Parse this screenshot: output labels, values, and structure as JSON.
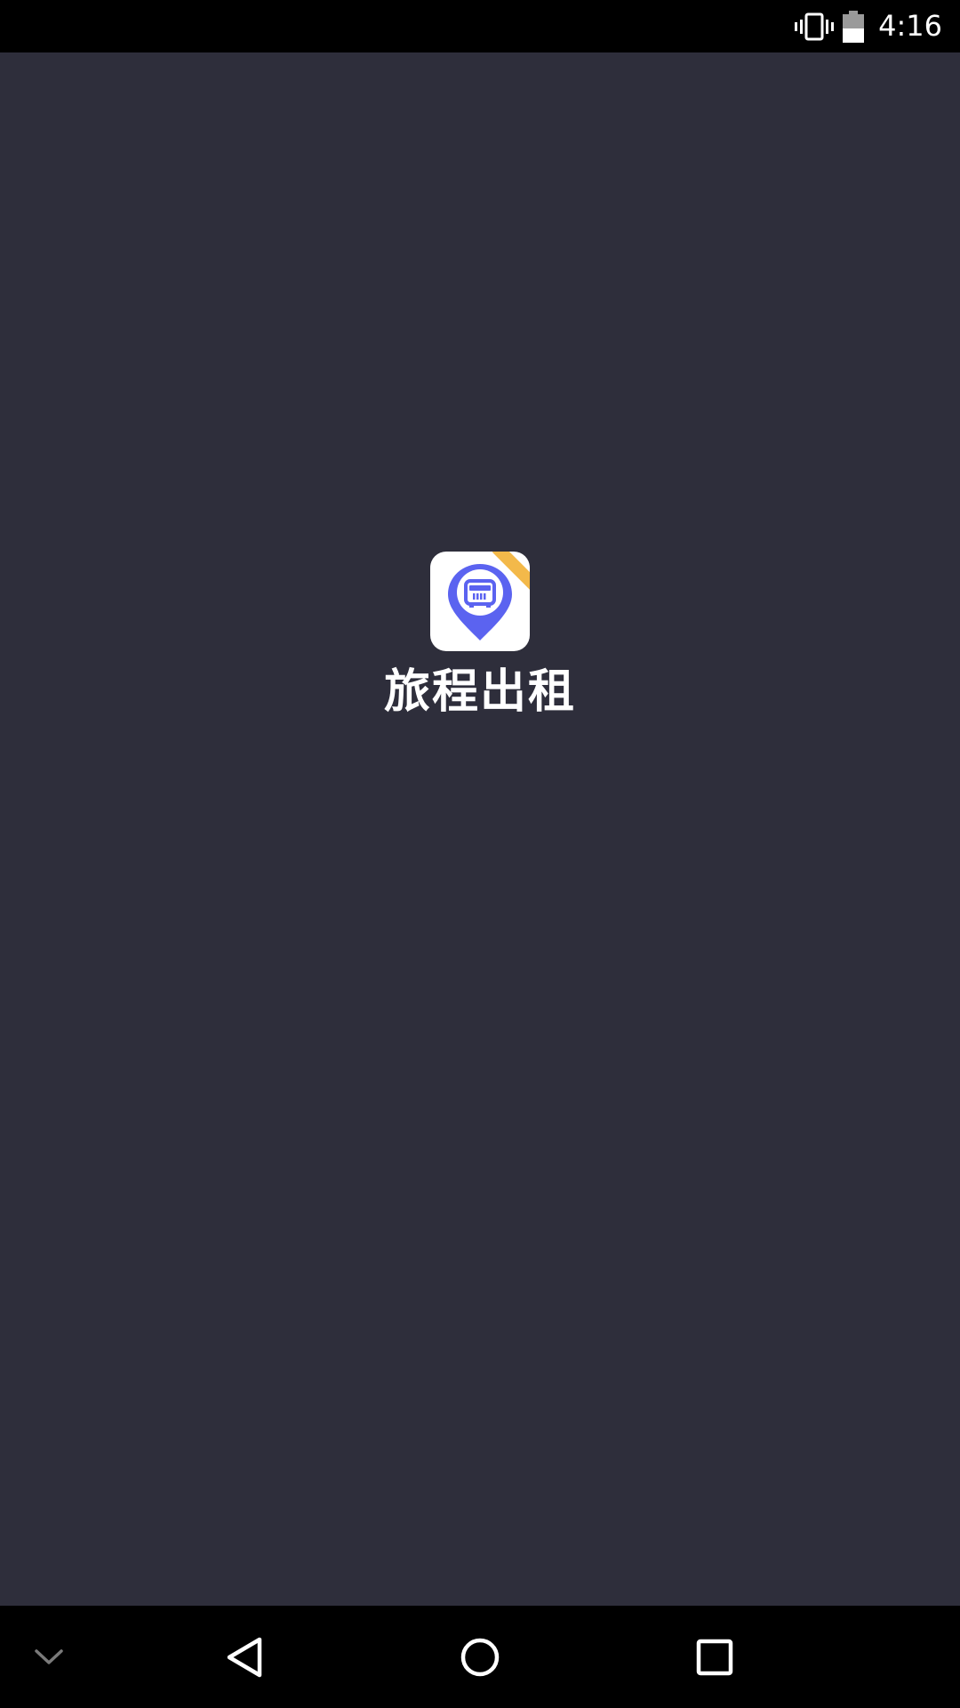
{
  "status_bar": {
    "time": "4:16",
    "icons": [
      "vibrate-icon",
      "battery-icon"
    ]
  },
  "splash": {
    "app_name": "旅程出租",
    "icon": "taxi-location-pin-icon",
    "colors": {
      "background": "#2e2e3b",
      "icon_accent": "#5b63f0",
      "ribbon": "#f3b94a"
    }
  },
  "nav_bar": {
    "buttons": [
      "collapse-chevron-icon",
      "back-icon",
      "home-icon",
      "recents-icon"
    ]
  }
}
